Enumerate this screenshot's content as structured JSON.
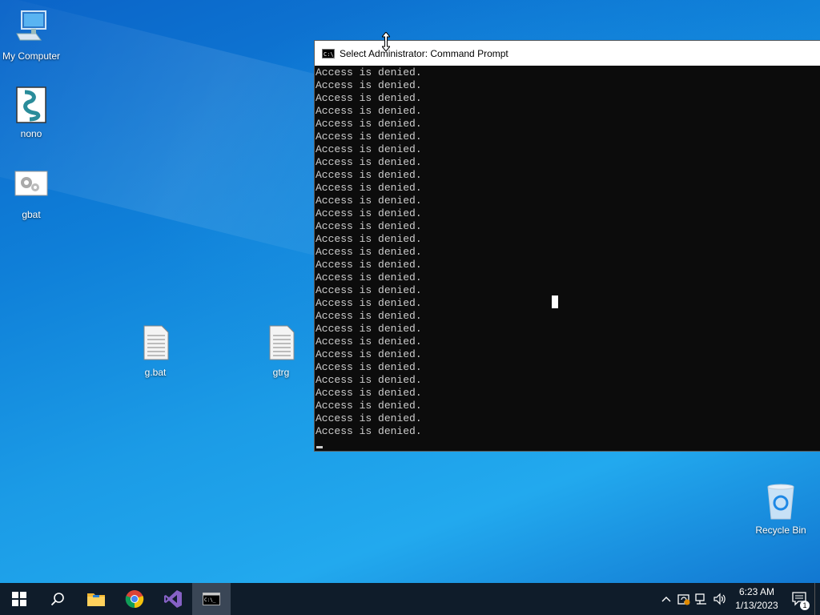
{
  "desktop": {
    "icons": {
      "my_computer": "My Computer",
      "nono": "nono",
      "gbat": "gbat",
      "g_bat": "g.bat",
      "gtrg": "gtrg",
      "recycle_bin": "Recycle Bin"
    }
  },
  "console": {
    "title": "Select Administrator:  Command Prompt",
    "icon_text": "C:\\_",
    "lines": [
      "Access is denied.",
      "Access is denied.",
      "Access is denied.",
      "Access is denied.",
      "Access is denied.",
      "Access is denied.",
      "Access is denied.",
      "Access is denied.",
      "Access is denied.",
      "Access is denied.",
      "Access is denied.",
      "Access is denied.",
      "Access is denied.",
      "Access is denied.",
      "Access is denied.",
      "Access is denied.",
      "Access is denied.",
      "Access is denied.",
      "Access is denied.",
      "Access is denied.",
      "Access is denied.",
      "Access is denied.",
      "Access is denied.",
      "Access is denied.",
      "Access is denied.",
      "Access is denied.",
      "Access is denied.",
      "Access is denied.",
      "Access is denied."
    ]
  },
  "taskbar": {
    "apps": [
      "start-icon",
      "search-icon",
      "file-explorer-icon",
      "chrome-icon",
      "visual-studio-icon",
      "command-prompt-icon"
    ],
    "clock": {
      "time": "6:23 AM",
      "date": "1/13/2023"
    },
    "notification_count": "1"
  }
}
